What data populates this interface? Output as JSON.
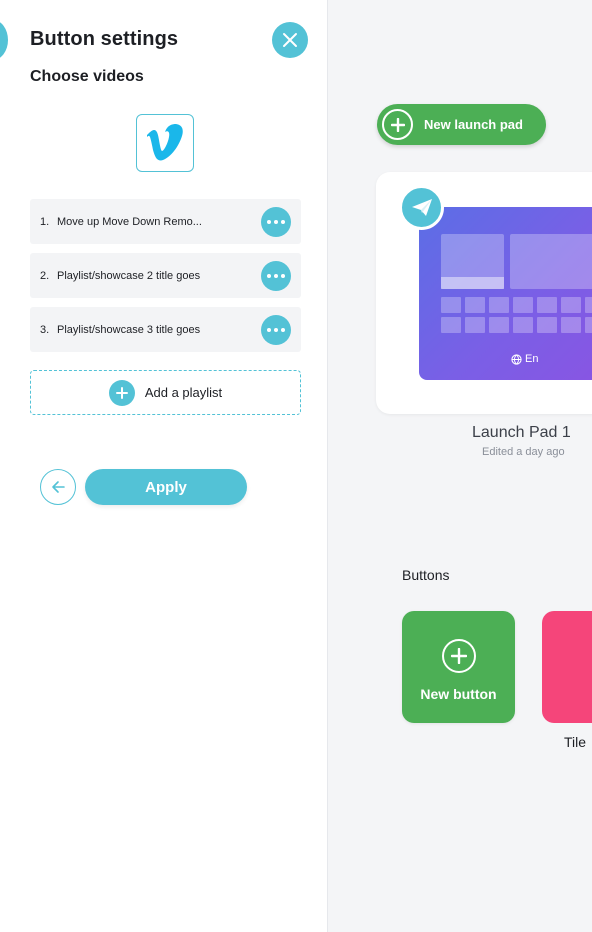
{
  "panel": {
    "title": "Button settings",
    "subtitle": "Choose videos",
    "icons": {
      "close": "close-icon",
      "provider": "vimeo-logo",
      "back": "arrow-left-icon"
    },
    "playlists": [
      {
        "num": "1.",
        "title": "Move up Move Down Remo..."
      },
      {
        "num": "2.",
        "title": "Playlist/showcase 2 title goes"
      },
      {
        "num": "3.",
        "title": "Playlist/showcase 3 title goes"
      }
    ],
    "add_playlist_label": "Add a playlist",
    "apply_label": "Apply"
  },
  "main": {
    "new_launch_pad_label": "New launch pad",
    "launch_pad": {
      "name": "Launch Pad 1",
      "edited": "Edited a day ago",
      "language": "En"
    },
    "buttons_section_label": "Buttons",
    "tiles": [
      {
        "label": "New button",
        "color": "#4caf55"
      },
      {
        "label": "Tile",
        "color": "#f5457a"
      }
    ]
  },
  "colors": {
    "accent": "#53c2d6",
    "green": "#4caf55",
    "pink": "#f5457a"
  }
}
